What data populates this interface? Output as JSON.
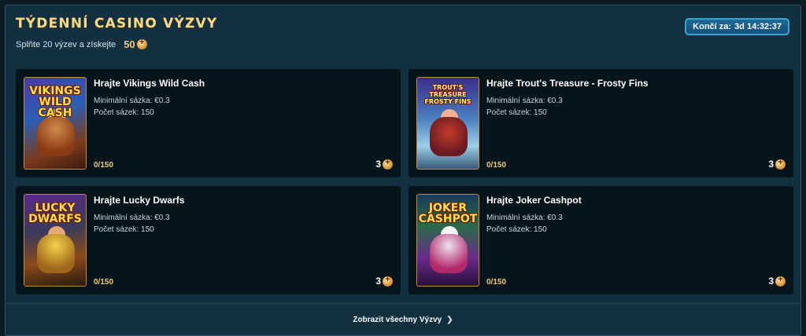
{
  "header": {
    "title": "Týdenní Casino Výzvy",
    "subtitle": "Splňte 20 výzev a získejte",
    "reward": "50",
    "timer_label": "Končí za:",
    "timer_value": "3d 14:32:37"
  },
  "challenges": [
    {
      "title": "Hrajte Vikings Wild Cash",
      "thumb_logo": "VIKINGS WILD CASH",
      "min_bet": "Minimální sázka: €0.3",
      "bet_count": "Počet sázek: 150",
      "progress": "0/150",
      "reward": "3"
    },
    {
      "title": "Hrajte Trout's Treasure - Frosty Fins",
      "thumb_logo": "TROUT'S TREASURE FROSTY FINS",
      "min_bet": "Minimální sázka: €0.3",
      "bet_count": "Počet sázek: 150",
      "progress": "0/150",
      "reward": "3"
    },
    {
      "title": "Hrajte Lucky Dwarfs",
      "thumb_logo": "LUCKY DWARFS",
      "min_bet": "Minimální sázka: €0.3",
      "bet_count": "Počet sázek: 150",
      "progress": "0/150",
      "reward": "3"
    },
    {
      "title": "Hrajte Joker Cashpot",
      "thumb_logo": "JOKER CASHPOT",
      "min_bet": "Minimální sázka: €0.3",
      "bet_count": "Počet sázek: 150",
      "progress": "0/150",
      "reward": "3"
    }
  ],
  "footer": {
    "link_label": "Zobrazit všechny Výzvy"
  },
  "icons": {
    "reward": "coin-icon",
    "footer_arrow": "chevron-right-icon"
  },
  "colors": {
    "accent_gold": "#f3c97a",
    "panel_bg": "#123040",
    "card_bg": "#06141c",
    "timer_bg": "#1f6a94"
  }
}
